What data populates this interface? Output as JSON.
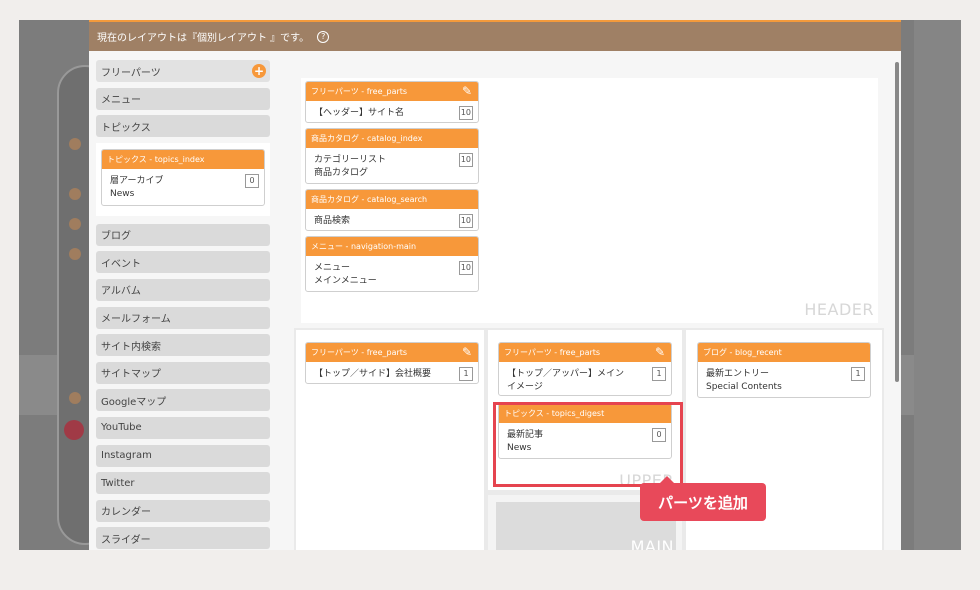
{
  "modal": {
    "title": "現在のレイアウトは『個別レイアウト 』です。",
    "help_glyph": "?"
  },
  "sidebar": {
    "items_top": [
      "フリーパーツ",
      "メニュー",
      "トピックス"
    ],
    "card": {
      "head": "トピックス - topics_index",
      "line1": "層アーカイブ",
      "line2": "News",
      "count": "0"
    },
    "items_bottom": [
      "ブログ",
      "イベント",
      "アルバム",
      "メールフォーム",
      "サイト内検索",
      "サイトマップ",
      "Googleマップ",
      "YouTube",
      "Instagram",
      "Twitter",
      "カレンダー",
      "スライダー"
    ]
  },
  "header_area": {
    "label": "HEADER",
    "cards": [
      {
        "head": "フリーパーツ - free_parts",
        "line1": "【ヘッダー】サイト名",
        "line2": "",
        "count": "10",
        "editable": true
      },
      {
        "head": "商品カタログ - catalog_index",
        "line1": "カテゴリーリスト",
        "line2": "商品カタログ",
        "count": "10",
        "editable": false
      },
      {
        "head": "商品カタログ - catalog_search",
        "line1": "商品検索",
        "line2": "",
        "count": "10",
        "editable": false
      },
      {
        "head": "メニュー - navigation-main",
        "line1": "メニュー",
        "line2": "メインメニュー",
        "count": "10",
        "editable": false
      }
    ]
  },
  "left_col": {
    "card": {
      "head": "フリーパーツ - free_parts",
      "line1": "【トップ／サイド】会社概要",
      "line2": "",
      "count": "1"
    }
  },
  "upper_col": {
    "label": "UPPER",
    "card1": {
      "head": "フリーパーツ - free_parts",
      "line1": "【トップ／アッパー】メイン",
      "line2": "イメージ",
      "count": "1"
    },
    "card2": {
      "head": "トピックス - topics_digest",
      "line1": "最新記事",
      "line2": "News",
      "count": "0"
    }
  },
  "main_label": "MAIN",
  "right_col": {
    "card": {
      "head": "ブログ - blog_recent",
      "line1": "最新エントリー",
      "line2": "Special Contents",
      "count": "1"
    }
  },
  "tooltip": "パーツを追加",
  "icons": {
    "pencil": "✎",
    "plus": "+"
  },
  "colors": {
    "accent": "#f7983a",
    "header_bar": "#9f8065",
    "highlight": "#e5444f"
  }
}
